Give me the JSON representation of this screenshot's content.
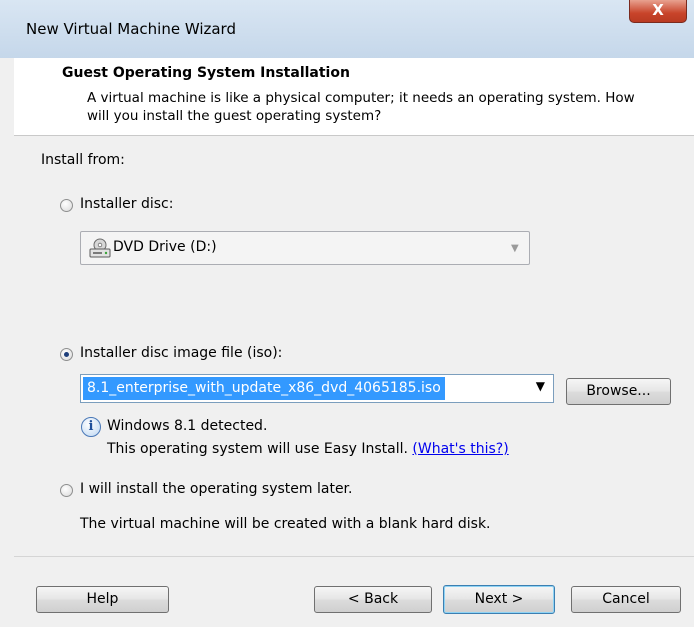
{
  "window": {
    "title": "New Virtual Machine Wizard",
    "close_glyph": "X"
  },
  "header": {
    "title": "Guest Operating System Installation",
    "description": "A virtual machine is like a physical computer; it needs an operating system. How will you install the guest operating system?"
  },
  "install_from": {
    "label": "Install from:",
    "options": [
      {
        "label": "Installer disc:",
        "selected": false
      },
      {
        "label": "Installer disc image file (iso):",
        "selected": true
      },
      {
        "label": "I will install the operating system later.",
        "selected": false
      }
    ],
    "disc_drive": {
      "value": "DVD Drive (D:)",
      "icon": "dvd-drive-icon"
    },
    "iso_path": "8.1_enterprise_with_update_x86_dvd_4065185.iso",
    "browse_label": "Browse...",
    "detected": "Windows 8.1 detected.",
    "easy_install": "This operating system will use Easy Install.",
    "whats_this": "(What's this?)",
    "later_desc": "The virtual machine will be created with a blank hard disk."
  },
  "footer": {
    "help": "Help",
    "back": "< Back",
    "next": "Next >",
    "cancel": "Cancel"
  },
  "colors": {
    "selection": "#3399ff",
    "link": "#0000ee",
    "close": "#c8442a"
  }
}
